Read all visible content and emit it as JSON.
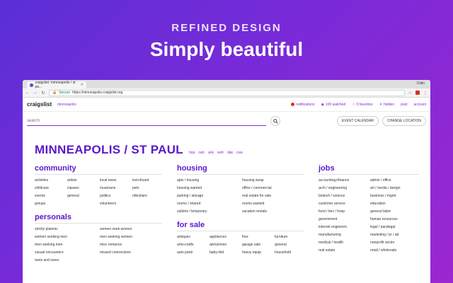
{
  "hero": {
    "subtitle": "REFINED DESIGN",
    "title": "Simply beautiful"
  },
  "browser": {
    "tab_title": "craigslist: minneapolis / st pa...",
    "user": "Colin",
    "secure_label": "Secure",
    "url": "https://minneapolis.craigslist.org"
  },
  "site": {
    "logo": "craigslist",
    "city_link": "minneapolis",
    "actions": [
      "notifications",
      "100 watched",
      "0 favorites",
      "hidden",
      "post",
      "account"
    ]
  },
  "search": {
    "placeholder": "search",
    "event_calendar": "EVENT CALENDAR",
    "change_location": "CHANGE LOCATION"
  },
  "city": {
    "title": "MINNEAPOLIS / ST PAUL",
    "nearby": [
      "hnp",
      "ram",
      "ank",
      "wsh",
      "dak",
      "csw"
    ]
  },
  "community": {
    "title": "community",
    "items": [
      "activities",
      "artists",
      "local news",
      "lost+found",
      "childcare",
      "classes",
      "musicians",
      "pets",
      "events",
      "general",
      "politics",
      "rideshare",
      "groups",
      "",
      "volunteers",
      ""
    ]
  },
  "personals": {
    "title": "personals",
    "items": [
      "strictly platonic",
      "women seek women",
      "women seeking men",
      "men seeking women",
      "men seeking men",
      "misc romance",
      "casual encounters",
      "missed connections",
      "rants and raves",
      ""
    ]
  },
  "housing": {
    "title": "housing",
    "items": [
      "apts / housing",
      "housing swap",
      "housing wanted",
      "office / commercial",
      "parking / storage",
      "real estate for sale",
      "rooms / shared",
      "rooms wanted",
      "sublets / temporary",
      "vacation rentals"
    ]
  },
  "for_sale": {
    "title": "for sale",
    "items": [
      "antiques",
      "appliances",
      "free",
      "furniture",
      "arts+crafts",
      "atv/utv/sno",
      "garage sale",
      "general",
      "auto parts",
      "baby+kid",
      "heavy equip",
      "household"
    ]
  },
  "jobs": {
    "title": "jobs",
    "items": [
      "accounting+finance",
      "admin / office",
      "arch / engineering",
      "art / media / design",
      "biotech / science",
      "business / mgmt",
      "customer service",
      "education",
      "food / bev / hosp",
      "general labor",
      "government",
      "human resources",
      "internet engineers",
      "legal / paralegal",
      "manufacturing",
      "marketing / pr / ad",
      "medical / health",
      "nonprofit sector",
      "real estate",
      "retail / wholesale"
    ]
  }
}
